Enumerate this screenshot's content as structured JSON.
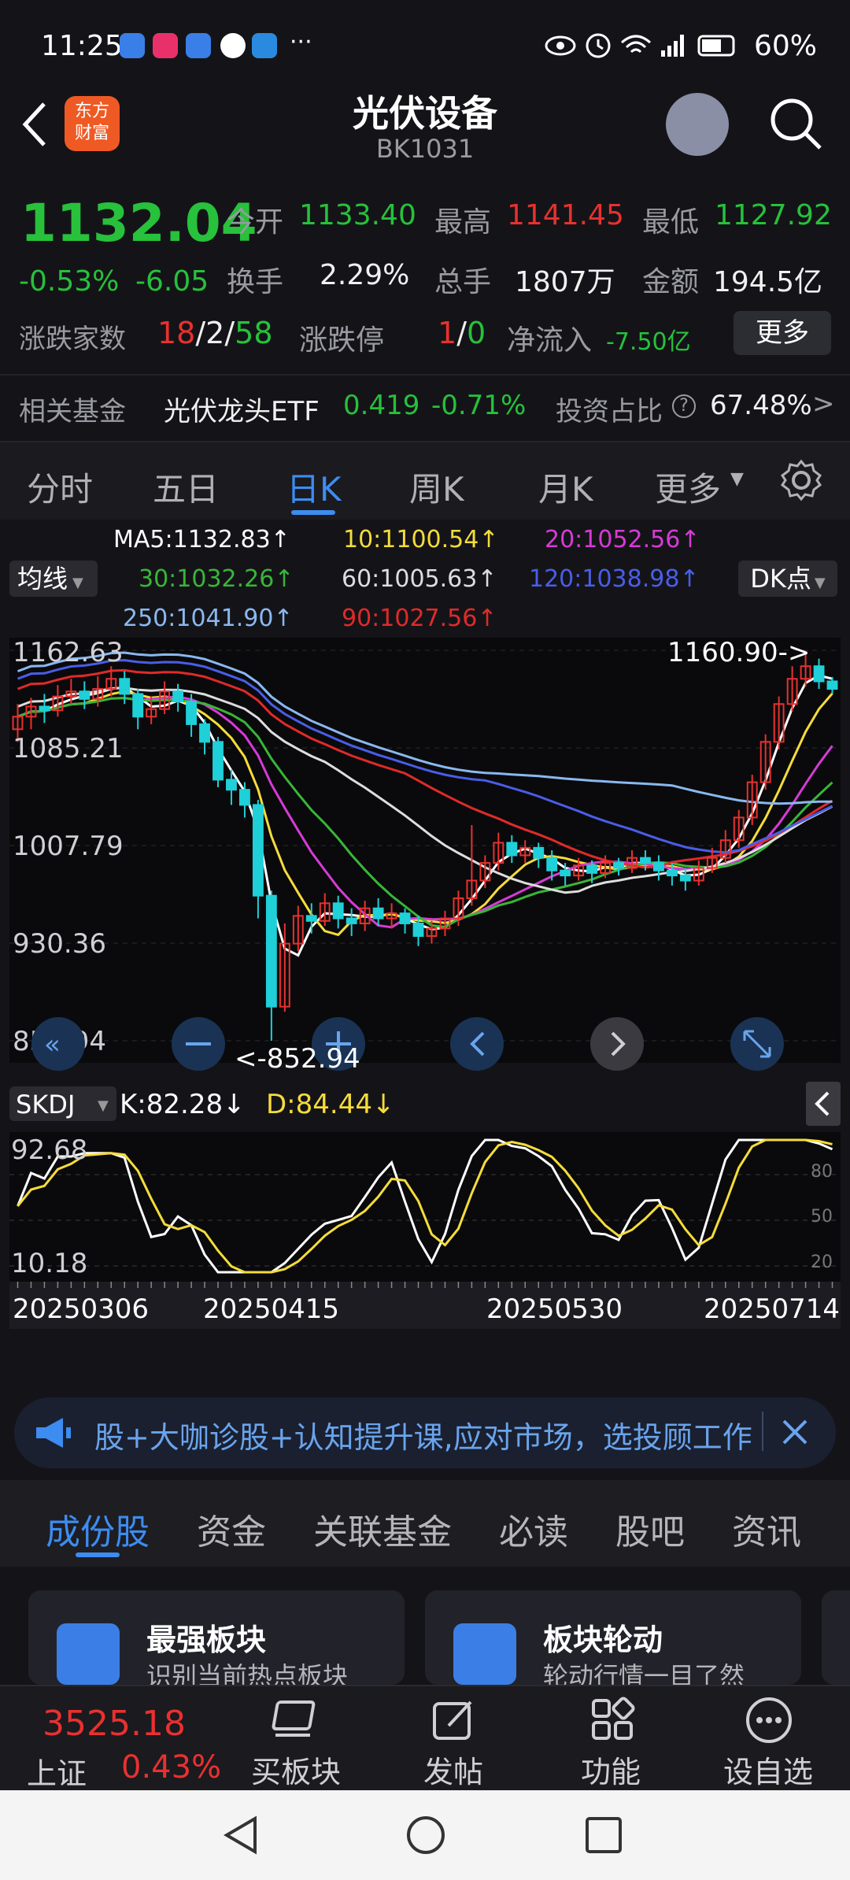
{
  "status_bar": {
    "time": "11:25",
    "more": "···",
    "battery": "60%"
  },
  "header": {
    "title": "光伏设备",
    "code": "BK1031",
    "logo_text": "东方\n财富",
    "logo_line1": "东方",
    "logo_line2": "财富"
  },
  "quote": {
    "price": "1132.04",
    "change_pct": "-0.53%",
    "change": "-6.05",
    "open_label": "今开",
    "open": "1133.40",
    "high_label": "最高",
    "high": "1141.45",
    "low_label": "最低",
    "low": "1127.92",
    "turnover_label": "换手",
    "turnover": "2.29%",
    "volume_label": "总手",
    "volume": "1807万",
    "amount_label": "金额",
    "amount": "194.5亿",
    "updown_label": "涨跌家数",
    "up_count": "18",
    "flat_count": "2",
    "down_count": "58",
    "slash": "/",
    "limit_label": "涨跌停",
    "limit_up": "1",
    "limit_down": "0",
    "netflow_label": "净流入",
    "netflow": "-7.50亿",
    "more_button": "更多",
    "fund_label": "相关基金",
    "fund_name": "光伏龙头ETF",
    "fund_price": "0.419",
    "fund_change": "-0.71%",
    "ratio_label": "投资占比",
    "ratio_value": "67.48%",
    "ratio_arrow": ">"
  },
  "period_tabs": [
    "分时",
    "五日",
    "日K",
    "周K",
    "月K",
    "更多"
  ],
  "active_period": "日K",
  "ma_legend": {
    "ma5": "MA5:1132.83↑",
    "ma10": "10:1100.54↑",
    "ma20": "20:1052.56↑",
    "ma30": "30:1032.26↑",
    "ma60": "60:1005.63↑",
    "ma120": "120:1038.98↑",
    "ma250": "250:1041.90↑",
    "ma90": "90:1027.56↑",
    "selector": "均线",
    "dk_button": "DK点"
  },
  "colors": {
    "ma5": "#ffffff",
    "ma10": "#f5dc3a",
    "ma20": "#d63bd6",
    "ma30": "#39b539",
    "ma60": "#dddddd",
    "ma120": "#4a5de8",
    "ma250": "#8ab8f0",
    "ma90": "#e02a2a",
    "up": "#e8312f",
    "down": "#1fd0d8",
    "accent": "#3d8cf0"
  },
  "chart_data": {
    "type": "candlestick",
    "y_ticks": [
      "1162.63",
      "1085.21",
      "1007.79",
      "930.36",
      "852.94"
    ],
    "ylim": [
      852.94,
      1162.63
    ],
    "max_label": "1160.90->",
    "min_label": "<-852.94",
    "x_ticks": [
      "20250306",
      "20250415",
      "20250530",
      "20250714"
    ],
    "candles": [
      [
        1100,
        1110,
        1090,
        1120
      ],
      [
        1110,
        1118,
        1100,
        1125
      ],
      [
        1118,
        1115,
        1105,
        1128
      ],
      [
        1115,
        1126,
        1110,
        1135
      ],
      [
        1126,
        1130,
        1120,
        1140
      ],
      [
        1130,
        1124,
        1116,
        1138
      ],
      [
        1124,
        1132,
        1118,
        1142
      ],
      [
        1132,
        1140,
        1126,
        1150
      ],
      [
        1140,
        1128,
        1120,
        1146
      ],
      [
        1128,
        1110,
        1100,
        1132
      ],
      [
        1110,
        1116,
        1104,
        1126
      ],
      [
        1116,
        1130,
        1112,
        1138
      ],
      [
        1130,
        1122,
        1114,
        1136
      ],
      [
        1122,
        1104,
        1094,
        1128
      ],
      [
        1104,
        1090,
        1080,
        1108
      ],
      [
        1090,
        1060,
        1054,
        1094
      ],
      [
        1060,
        1052,
        1040,
        1068
      ],
      [
        1052,
        1040,
        1030,
        1058
      ],
      [
        1040,
        968,
        950,
        1044
      ],
      [
        968,
        880,
        852.94,
        972
      ],
      [
        880,
        930,
        876,
        946
      ],
      [
        930,
        952,
        924,
        960
      ],
      [
        952,
        948,
        938,
        962
      ],
      [
        948,
        962,
        944,
        970
      ],
      [
        962,
        950,
        942,
        968
      ],
      [
        950,
        946,
        936,
        958
      ],
      [
        946,
        958,
        940,
        964
      ],
      [
        958,
        950,
        944,
        966
      ],
      [
        950,
        954,
        942,
        962
      ],
      [
        954,
        946,
        938,
        958
      ],
      [
        946,
        936,
        928,
        952
      ],
      [
        936,
        942,
        930,
        948
      ],
      [
        942,
        950,
        936,
        956
      ],
      [
        950,
        966,
        944,
        972
      ],
      [
        966,
        980,
        960,
        1024
      ],
      [
        980,
        994,
        974,
        1000
      ],
      [
        994,
        1010,
        988,
        1018
      ],
      [
        1010,
        1000,
        994,
        1016
      ],
      [
        1000,
        1006,
        994,
        1012
      ],
      [
        1006,
        998,
        990,
        1010
      ],
      [
        998,
        988,
        980,
        1004
      ],
      [
        988,
        984,
        976,
        994
      ],
      [
        984,
        992,
        980,
        998
      ],
      [
        992,
        986,
        978,
        996
      ],
      [
        986,
        994,
        982,
        1000
      ],
      [
        994,
        990,
        984,
        998
      ],
      [
        990,
        998,
        986,
        1004
      ],
      [
        998,
        994,
        988,
        1004
      ],
      [
        994,
        988,
        980,
        1000
      ],
      [
        988,
        984,
        976,
        994
      ],
      [
        984,
        980,
        972,
        990
      ],
      [
        980,
        990,
        976,
        996
      ],
      [
        990,
        998,
        986,
        1006
      ],
      [
        998,
        1012,
        994,
        1020
      ],
      [
        1012,
        1030,
        1006,
        1036
      ],
      [
        1030,
        1058,
        1024,
        1064
      ],
      [
        1058,
        1090,
        1052,
        1096
      ],
      [
        1090,
        1120,
        1084,
        1126
      ],
      [
        1120,
        1140,
        1114,
        1150
      ],
      [
        1140,
        1150,
        1134,
        1160.9
      ],
      [
        1150,
        1138,
        1132,
        1156
      ],
      [
        1138,
        1132,
        1128,
        1141.45
      ]
    ],
    "indicator": {
      "name": "SKDJ",
      "k": "K:82.28↓",
      "d": "D:84.44↓",
      "y_ticks": [
        "92.68",
        "10.18"
      ],
      "levels": [
        "80",
        "50",
        "20"
      ]
    }
  },
  "notice": {
    "text": "股+大咖诊股+认知提升课,应对市场，选投顾工作"
  },
  "content_tabs": [
    "成份股",
    "资金",
    "关联基金",
    "必读",
    "股吧",
    "资讯"
  ],
  "active_content_tab": "成份股",
  "cards": [
    {
      "title": "最强板块",
      "subtitle": "识别当前热点板块"
    },
    {
      "title": "板块轮动",
      "subtitle": "轮动行情一目了然"
    }
  ],
  "bottom_nav": {
    "index_value": "3525.18",
    "index_name": "上证",
    "index_change": "0.43%",
    "items": [
      "买板块",
      "发帖",
      "功能",
      "设自选"
    ]
  }
}
